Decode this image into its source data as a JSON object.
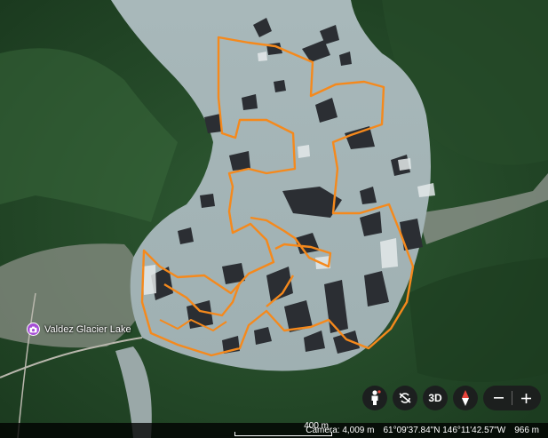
{
  "place": {
    "name": "Valdez Glacier Lake"
  },
  "status": {
    "scale_label": "400 m",
    "camera": "Camera: 4,009 m",
    "coordinates": "61°09'37.84\"N 146°11'42.57\"W",
    "elevation": "966 m"
  },
  "controls": {
    "three_d_label": "3D"
  },
  "colors": {
    "lake": "#a5b6b8",
    "forest": "#2c5430",
    "route": "#f5891c",
    "pin": "#a64fd6"
  },
  "icons": {
    "pegman": "pegman-icon",
    "rotate": "rotate-icon",
    "compass": "compass-icon",
    "zoom_in": "plus-icon",
    "zoom_out": "minus-icon",
    "pin": "camera-icon"
  }
}
